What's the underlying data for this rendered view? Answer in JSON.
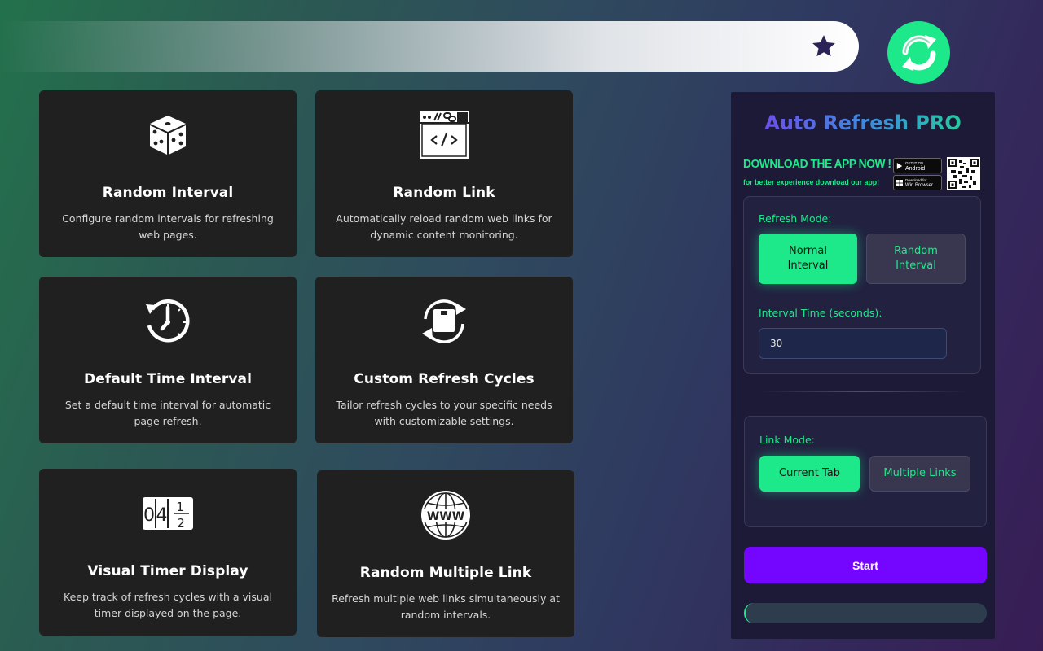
{
  "topbar": {
    "star_icon": "star-icon"
  },
  "logo": {
    "icon": "refresh-icon",
    "color": "#1de98a"
  },
  "features": [
    {
      "icon": "dice-icon",
      "title": "Random Interval",
      "description": "Configure random intervals for refreshing web pages."
    },
    {
      "icon": "code-link-icon",
      "title": "Random Link",
      "description": "Automatically reload random web links for dynamic content monitoring."
    },
    {
      "icon": "clock-history-icon",
      "title": "Default Time Interval",
      "description": "Set a default time interval for automatic page refresh."
    },
    {
      "icon": "refresh-cycle-icon",
      "title": "Custom Refresh Cycles",
      "description": "Tailor refresh cycles to your specific needs with customizable settings."
    },
    {
      "icon": "timer-counter-icon",
      "title": "Visual Timer Display",
      "description": "Keep track of refresh cycles with a visual timer displayed on the page."
    },
    {
      "icon": "globe-www-icon",
      "title": "Random Multiple Link",
      "description": "Refresh multiple web links simultaneously at random intervals."
    }
  ],
  "timer_digits": [
    "0",
    "4",
    "1",
    "2"
  ],
  "globe_text": "WWW",
  "panel": {
    "title": "Auto Refresh PRO",
    "download_title": "DOWNLOAD THE APP NOW !",
    "download_subtitle": "for better experience download our app!",
    "android_top": "GET IT ON",
    "android_label": "Android",
    "win_top": "Download for",
    "win_label": "Win Browser",
    "refresh_mode_label": "Refresh Mode:",
    "refresh_modes": [
      "Normal\nInterval",
      "Random\nInterval"
    ],
    "interval_label": "Interval Time (seconds):",
    "interval_value": "30",
    "link_mode_label": "Link Mode:",
    "link_modes": [
      "Current Tab",
      "Multiple Links"
    ],
    "start_label": "Start",
    "progress": 0
  },
  "colors": {
    "accent": "#1de98a",
    "start": "#7405ff",
    "panel_bg": "#1c1a36",
    "card_bg": "#202020"
  }
}
